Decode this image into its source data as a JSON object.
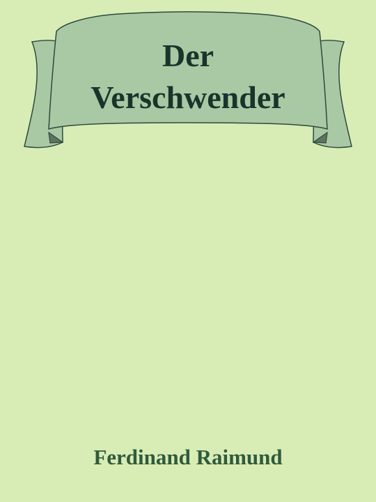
{
  "book": {
    "title_lines": [
      "Der",
      "Verschwender"
    ],
    "author": "Ferdinand Raimund"
  },
  "colors": {
    "background": "#d8edb6",
    "banner_fill": "#a8c9a4",
    "banner_fold": "#5f745f",
    "banner_outline": "#2f4a3c",
    "title_text": "#18352b",
    "author_text": "#315a3b"
  },
  "icons": {
    "banner": "ribbon-banner-icon"
  }
}
